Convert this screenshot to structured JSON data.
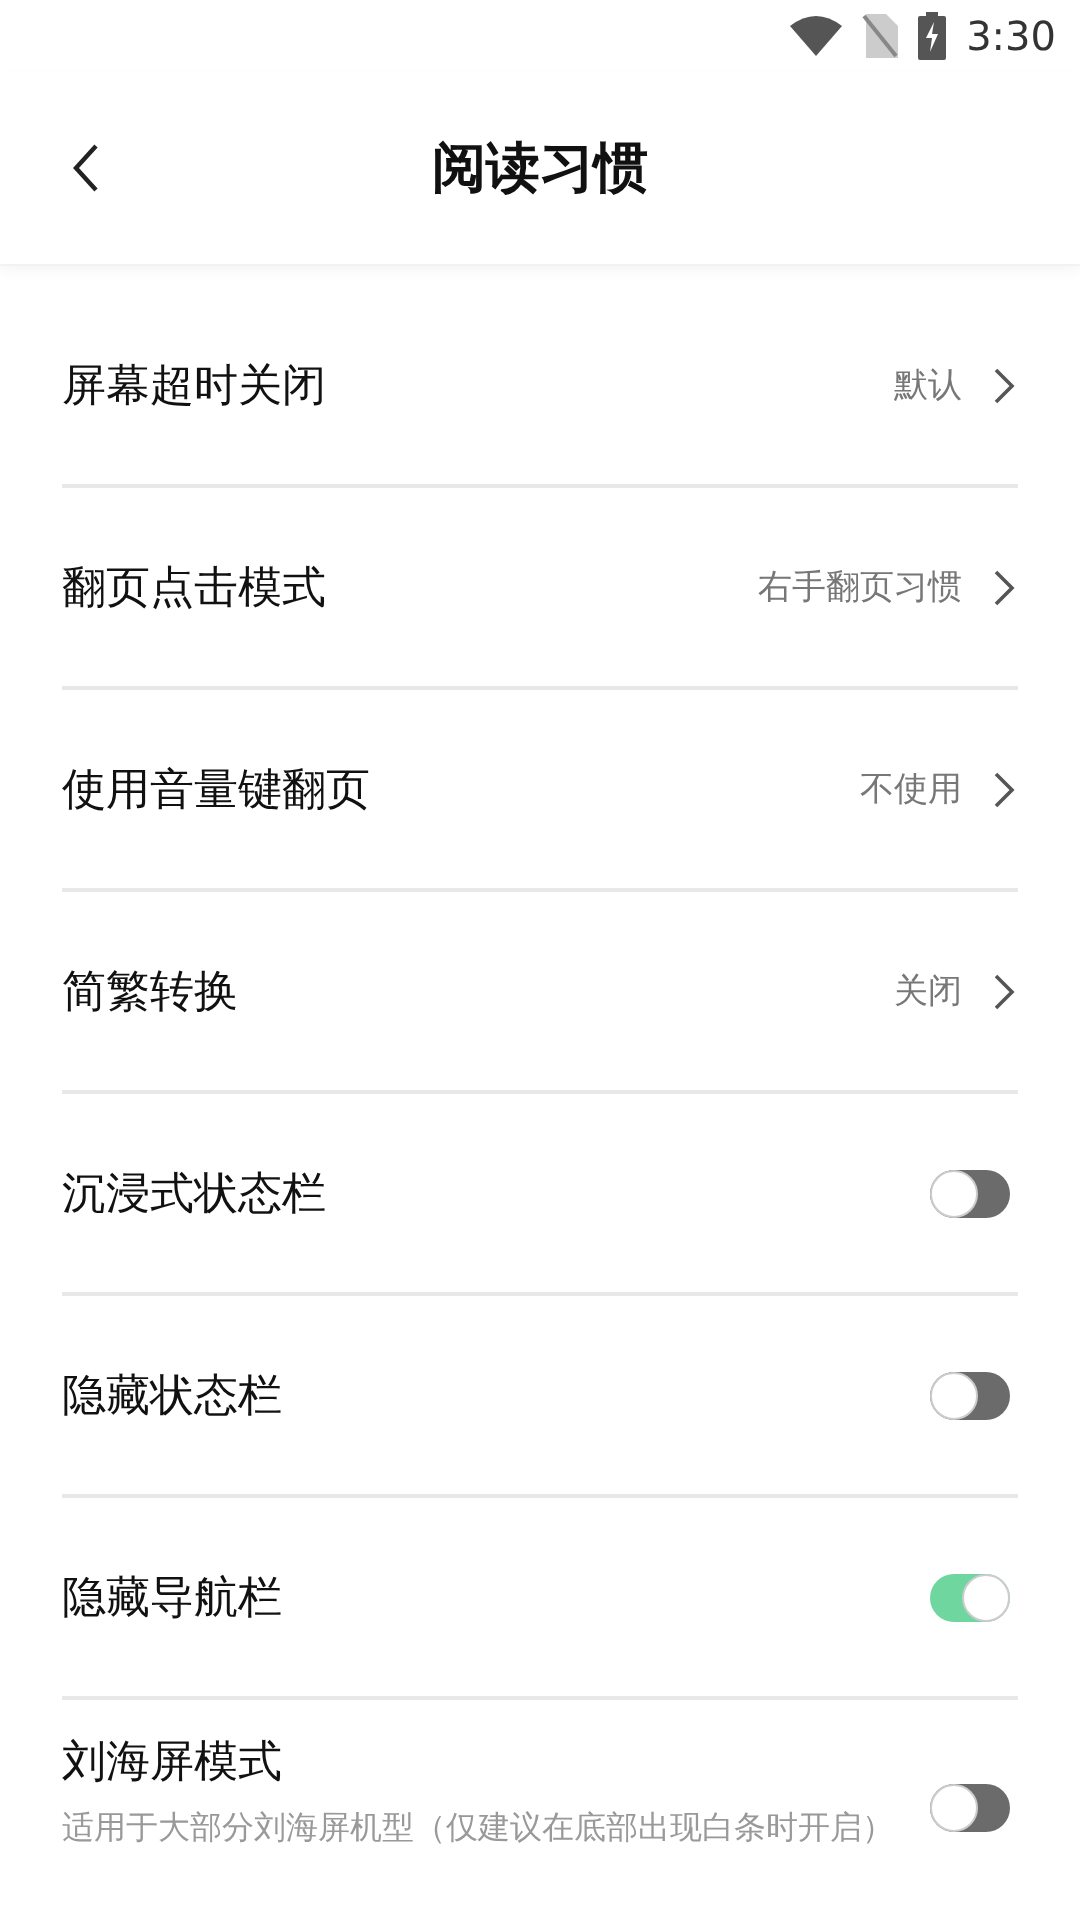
{
  "status_bar": {
    "time": "3:30"
  },
  "header": {
    "title": "阅读习惯"
  },
  "settings": [
    {
      "kind": "link",
      "label": "屏幕超时关闭",
      "value": "默认"
    },
    {
      "kind": "link",
      "label": "翻页点击模式",
      "value": "右手翻页习惯"
    },
    {
      "kind": "link",
      "label": "使用音量键翻页",
      "value": "不使用"
    },
    {
      "kind": "link",
      "label": "简繁转换",
      "value": "关闭"
    },
    {
      "kind": "toggle",
      "label": "沉浸式状态栏",
      "on": false
    },
    {
      "kind": "toggle",
      "label": "隐藏状态栏",
      "on": false
    },
    {
      "kind": "toggle",
      "label": "隐藏导航栏",
      "on": true
    },
    {
      "kind": "toggle",
      "label": "刘海屏模式",
      "on": false,
      "description": "适用于大部分刘海屏机型（仅建议在底部出现白条时开启）"
    }
  ]
}
